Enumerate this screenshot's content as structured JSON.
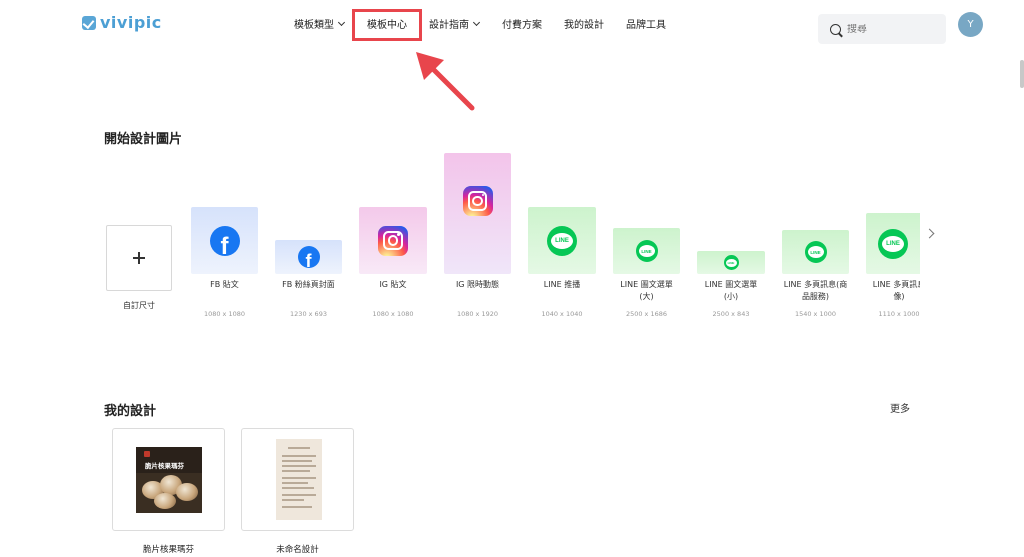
{
  "header": {
    "logo_text": "vivipic",
    "nav": [
      {
        "label": "模板類型",
        "has_chevron": true
      },
      {
        "label": "模板中心",
        "has_chevron": false,
        "highlighted": true
      },
      {
        "label": "設計指南",
        "has_chevron": true
      },
      {
        "label": "付費方案",
        "has_chevron": false
      },
      {
        "label": "我的設計",
        "has_chevron": false
      },
      {
        "label": "品牌工具",
        "has_chevron": false
      }
    ],
    "search_placeholder": "搜尋",
    "avatar_initial": "Y"
  },
  "start_section": {
    "title": "開始設計圖片",
    "custom_label": "自訂尺寸",
    "templates": [
      {
        "label": "FB 貼文",
        "size": "1080 x 1080",
        "icon": "facebook-icon"
      },
      {
        "label": "FB 粉絲頁封面",
        "size": "1230 x 693",
        "icon": "facebook-icon"
      },
      {
        "label": "IG 貼文",
        "size": "1080 x 1080",
        "icon": "instagram-icon"
      },
      {
        "label": "IG 限時動態",
        "size": "1080 x 1920",
        "icon": "instagram-icon"
      },
      {
        "label": "LINE 推播",
        "size": "1040 x 1040",
        "icon": "line-icon"
      },
      {
        "label": "LINE 圖文選單\n(大)",
        "size": "2500 x 1686",
        "icon": "line-icon"
      },
      {
        "label": "LINE 圖文選單\n(小)",
        "size": "2500 x 843",
        "icon": "line-icon"
      },
      {
        "label": "LINE 多頁訊息(商\n品服務)",
        "size": "1540 x 1000",
        "icon": "line-icon"
      },
      {
        "label": "LINE 多頁訊息\n像)",
        "size": "1110 x 1000",
        "icon": "line-icon"
      }
    ],
    "line_badge_text": "LINE"
  },
  "my_designs": {
    "title": "我的設計",
    "more_label": "更多",
    "items": [
      {
        "name": "脆片核果瑪芬",
        "thumb_title": "脆片核果瑪芬"
      },
      {
        "name": "未命名設計"
      }
    ]
  },
  "colors": {
    "brand": "#4c9fd4",
    "highlight": "#e8454c",
    "facebook": "#1877f2",
    "line": "#06c755"
  }
}
